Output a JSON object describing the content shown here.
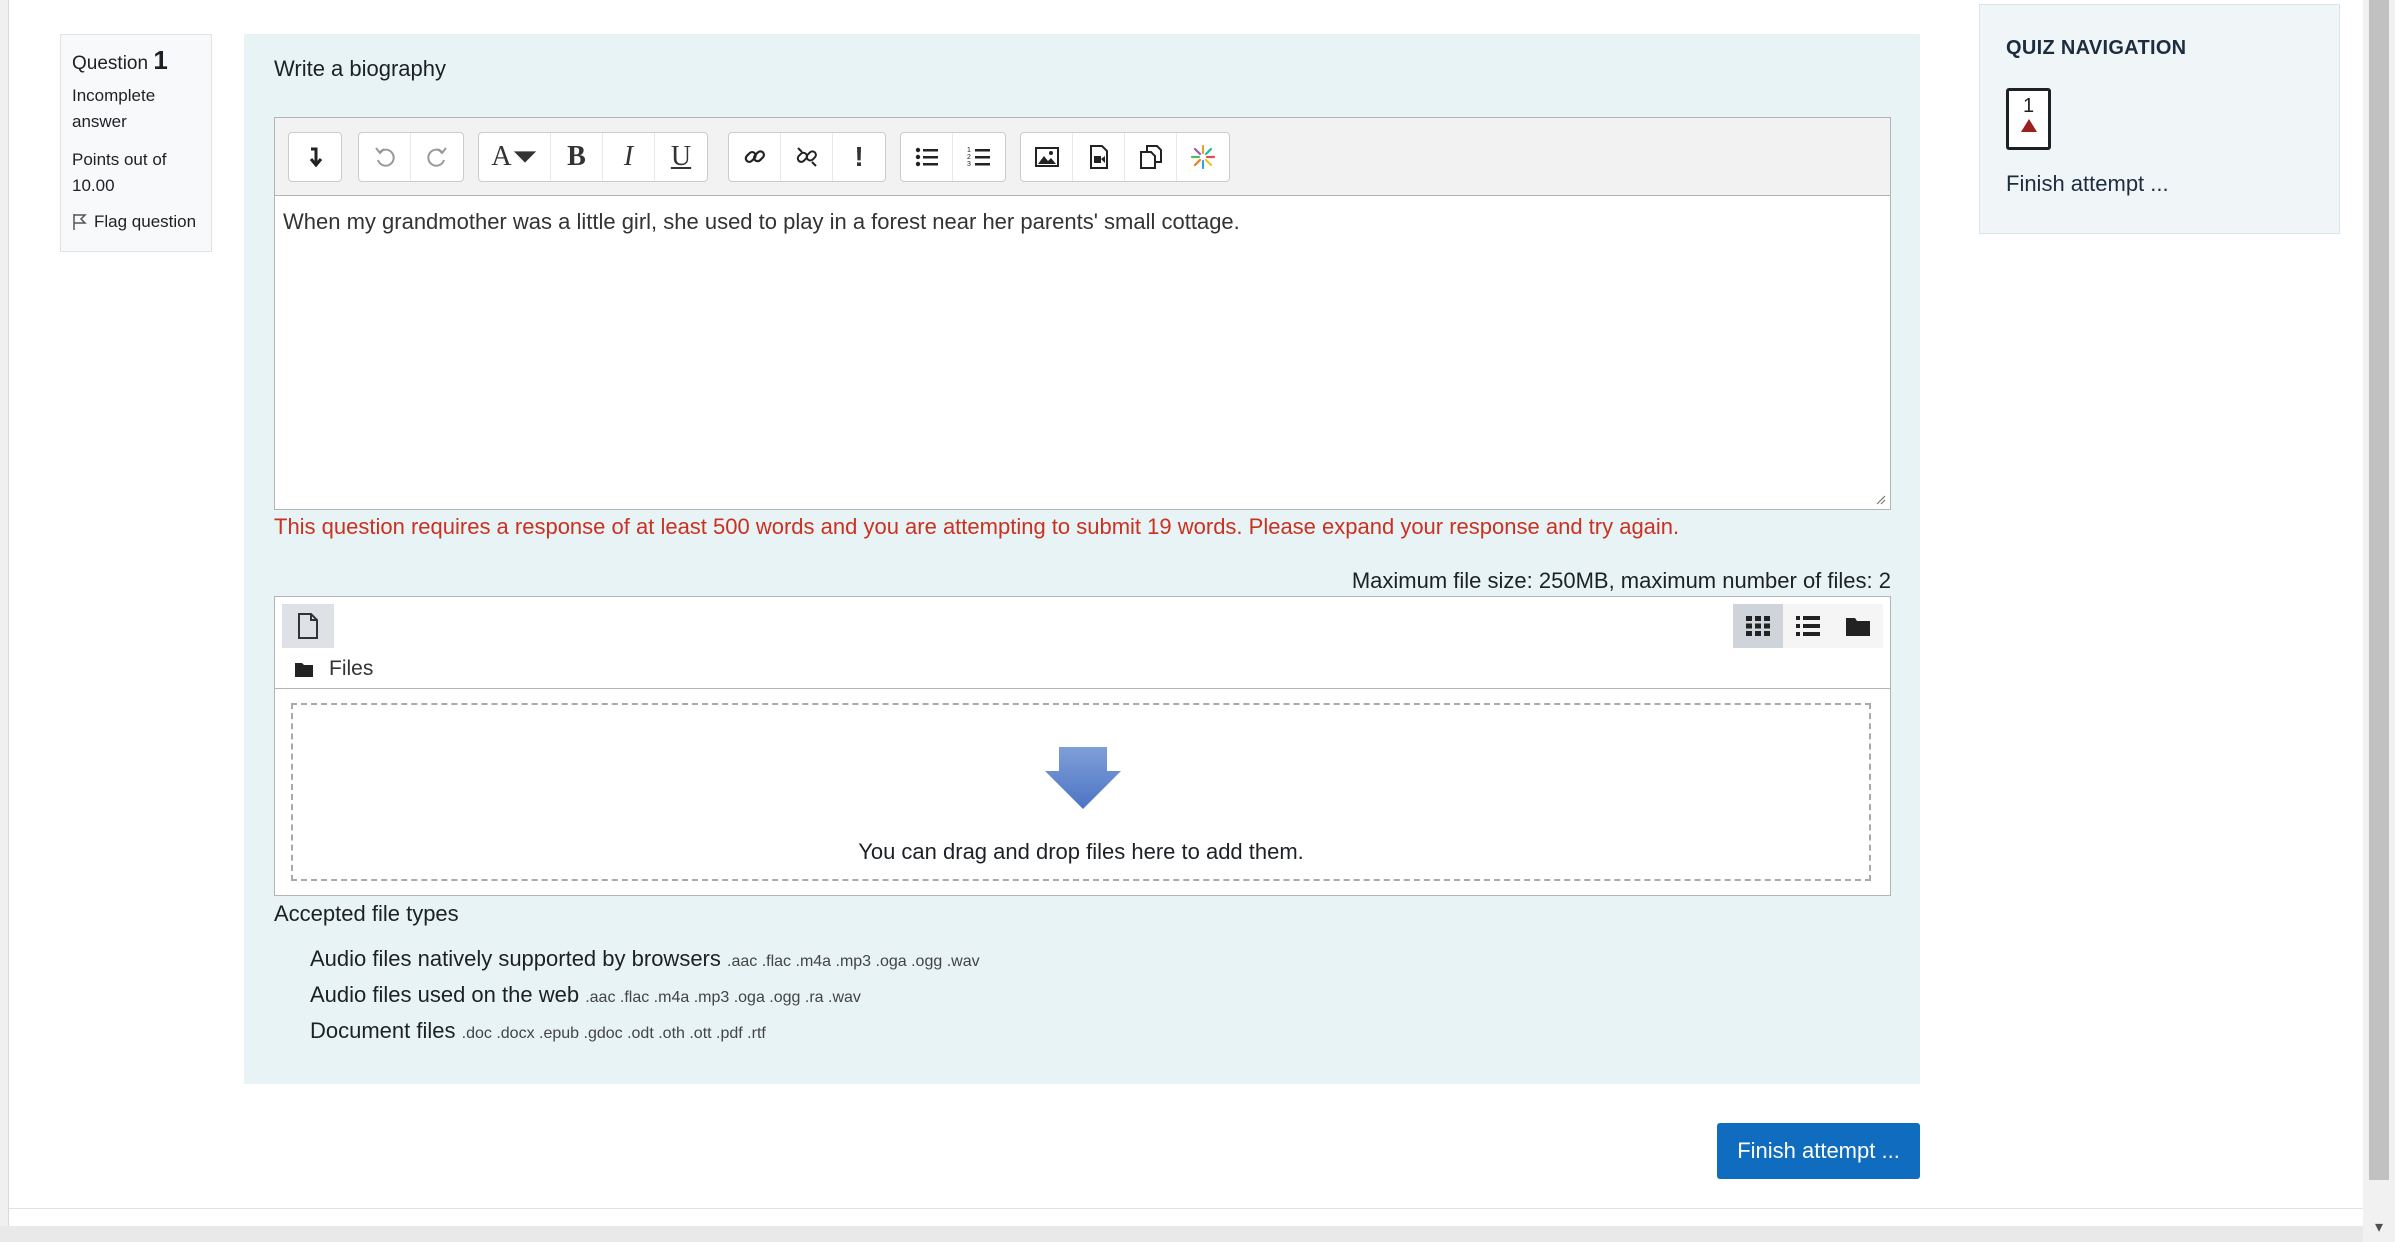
{
  "question_info": {
    "label": "Question",
    "number": "1",
    "state": "Incomplete answer",
    "grade": "Points out of 10.00",
    "flag_label": "Flag question"
  },
  "question": {
    "text": "Write a biography"
  },
  "editor": {
    "content": "When my grandmother was a little girl, she used to play in a forest near her parents' small cottage.",
    "toolbar_icons": [
      "collapse-icon",
      "undo-icon",
      "redo-icon",
      "font-style-icon",
      "bold-icon",
      "italic-icon",
      "underline-icon",
      "link-icon",
      "unlink-icon",
      "emoji-icon",
      "bullet-list-icon",
      "numbered-list-icon",
      "image-icon",
      "media-icon",
      "manage-files-icon",
      "recorder-icon"
    ],
    "bold_glyph": "B",
    "italic_glyph": "I",
    "underline_glyph": "U",
    "font_glyph": "A",
    "emoji_glyph": "!"
  },
  "validation_error": "This question requires a response of at least 500 words and you are attempting to submit 19 words. Please expand your response and try again.",
  "filemanager": {
    "max_info": "Maximum file size: 250MB, maximum number of files: 2",
    "path_label": "Files",
    "drop_text": "You can drag and drop files here to add them.",
    "views": [
      "grid-view-icon",
      "list-view-icon",
      "tree-view-icon"
    ],
    "active_view": "grid-view-icon"
  },
  "accepted": {
    "heading": "Accepted file types",
    "types": [
      {
        "name": "Audio files natively supported by browsers",
        "ext": ".aac .flac .m4a .mp3 .oga .ogg .wav"
      },
      {
        "name": "Audio files used on the web",
        "ext": ".aac .flac .m4a .mp3 .oga .ogg .ra .wav"
      },
      {
        "name": "Document files",
        "ext": ".doc .docx .epub .gdoc .odt .oth .ott .pdf .rtf"
      }
    ]
  },
  "finish_button": "Finish attempt ...",
  "quiz_nav": {
    "title": "QUIZ NAVIGATION",
    "question_button": "1",
    "finish_link": "Finish attempt ..."
  },
  "colors": {
    "accent": "#0f6cbf",
    "error": "#ca3120",
    "question_bg": "#e7f3f5",
    "flag_triangle": "#9a1f1f"
  }
}
